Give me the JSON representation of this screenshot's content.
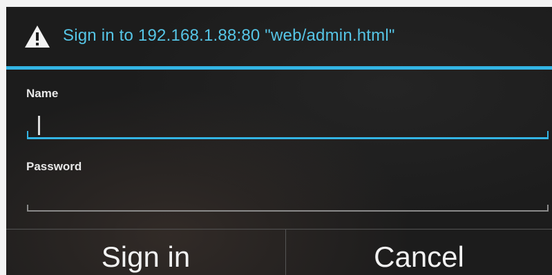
{
  "dialog": {
    "title": "Sign in to 192.168.1.88:80 \"web/admin.html\"",
    "title_icon": "warning-icon",
    "accent_color": "#33b5e5"
  },
  "fields": {
    "name_label": "Name",
    "name_value": "",
    "password_label": "Password",
    "password_value": ""
  },
  "buttons": {
    "sign_in": "Sign in",
    "cancel": "Cancel"
  }
}
